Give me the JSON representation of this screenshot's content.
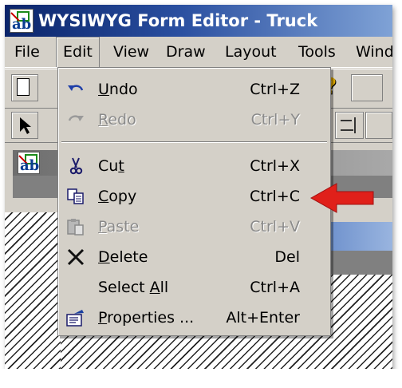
{
  "window": {
    "title": "WYSIWYG Form Editor - Truck",
    "app_icon": "ab-form-icon"
  },
  "menubar": {
    "items": [
      {
        "label": "File"
      },
      {
        "label": "Edit",
        "active": true
      },
      {
        "label": "View"
      },
      {
        "label": "Draw"
      },
      {
        "label": "Layout"
      },
      {
        "label": "Tools"
      },
      {
        "label": "Windo"
      }
    ]
  },
  "edit_menu": {
    "items": [
      {
        "label": "Undo",
        "mnemonic": "U",
        "shortcut": "Ctrl+Z",
        "icon": "undo-icon",
        "enabled": true
      },
      {
        "label": "Redo",
        "mnemonic": "R",
        "shortcut": "Ctrl+Y",
        "icon": "redo-icon",
        "enabled": false
      },
      {
        "label": "Cut",
        "mnemonic": "t",
        "shortcut": "Ctrl+X",
        "icon": "scissors-icon",
        "enabled": true
      },
      {
        "label": "Copy",
        "mnemonic": "C",
        "shortcut": "Ctrl+C",
        "icon": "copy-icon",
        "enabled": true
      },
      {
        "label": "Paste",
        "mnemonic": "P",
        "shortcut": "Ctrl+V",
        "icon": "paste-icon",
        "enabled": false
      },
      {
        "label": "Delete",
        "mnemonic": "D",
        "shortcut": "Del",
        "icon": "delete-x-icon",
        "enabled": true
      },
      {
        "label": "Select All",
        "mnemonic": "A",
        "shortcut": "Ctrl+A",
        "icon": "",
        "enabled": true
      },
      {
        "label": "Properties ...",
        "mnemonic": "P",
        "shortcut": "Alt+Enter",
        "icon": "properties-icon",
        "enabled": true
      }
    ]
  },
  "annotation": {
    "arrow_color": "#e0201a",
    "points_to": "Copy"
  },
  "colors": {
    "titlebar_start": "#0a246a",
    "face": "#d4d0c8",
    "disabled_text": "#8a8a8a"
  }
}
